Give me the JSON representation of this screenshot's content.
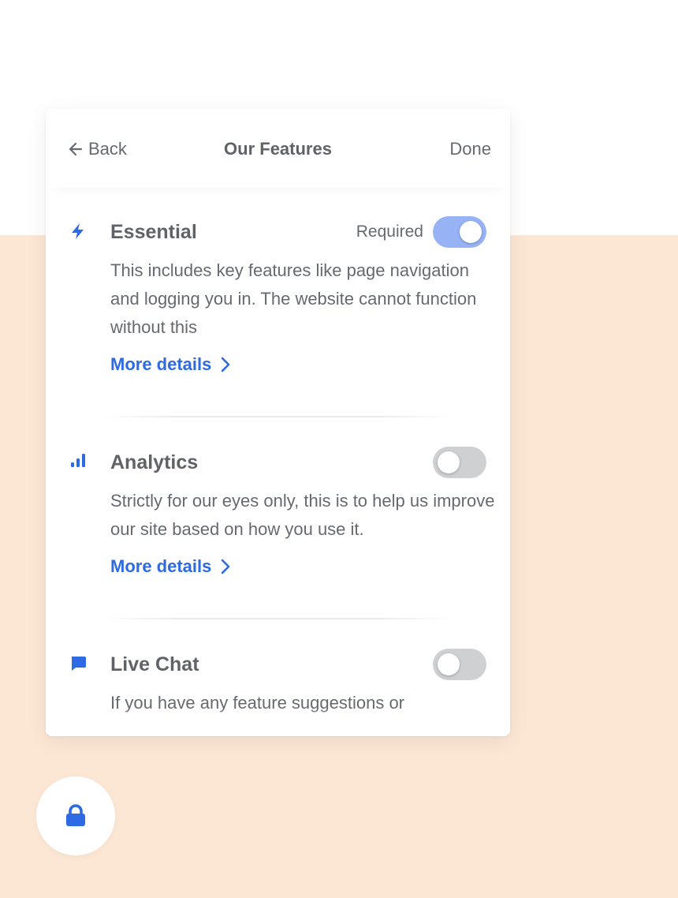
{
  "header": {
    "back_label": "Back",
    "title": "Our Features",
    "done_label": "Done"
  },
  "sections": [
    {
      "icon": "lightning-icon",
      "title": "Essential",
      "badge": "Required",
      "toggle_on": true,
      "description": "This includes key features like page navigation and logging you in. The website cannot function without this",
      "more_label": "More details"
    },
    {
      "icon": "bar-chart-icon",
      "title": "Analytics",
      "toggle_on": false,
      "description": "Strictly for our eyes only, this is to help us improve our site based on how you use it.",
      "more_label": "More details"
    },
    {
      "icon": "chat-bubble-icon",
      "title": "Live Chat",
      "toggle_on": false,
      "description": "If you have any feature suggestions or"
    }
  ],
  "fab": {
    "icon": "lock-icon"
  },
  "colors": {
    "accent": "#2d6ae3",
    "toggle_on": "#97b3f6",
    "toggle_off": "#cfd0d1",
    "page_background": "#fce7d5",
    "text": "#666a70"
  }
}
